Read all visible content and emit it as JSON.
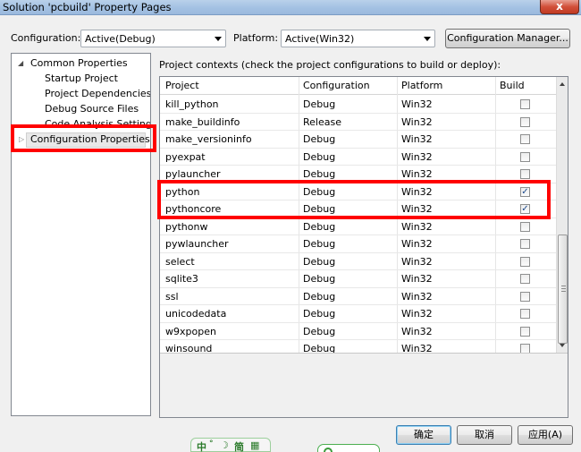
{
  "window": {
    "title": "Solution 'pcbuild' Property Pages",
    "close_label": "x"
  },
  "toolbar": {
    "configuration_label": "Configuration:",
    "configuration_value": "Active(Debug)",
    "platform_label": "Platform:",
    "platform_value": "Active(Win32)",
    "config_manager_label": "Configuration Manager..."
  },
  "tree": {
    "items": [
      {
        "label": "Common Properties"
      },
      {
        "label": "Startup Project"
      },
      {
        "label": "Project Dependencies"
      },
      {
        "label": "Debug Source Files"
      },
      {
        "label": "Code Analysis Settings"
      },
      {
        "label": "Configuration Properties"
      }
    ]
  },
  "main": {
    "instructions": "Project contexts (check the project configurations to build or deploy):",
    "columns": [
      "Project",
      "Configuration",
      "Platform",
      "Build"
    ],
    "rows": [
      {
        "project": "kill_python",
        "configuration": "Debug",
        "platform": "Win32",
        "build": false
      },
      {
        "project": "make_buildinfo",
        "configuration": "Release",
        "platform": "Win32",
        "build": false
      },
      {
        "project": "make_versioninfo",
        "configuration": "Debug",
        "platform": "Win32",
        "build": false
      },
      {
        "project": "pyexpat",
        "configuration": "Debug",
        "platform": "Win32",
        "build": false
      },
      {
        "project": "pylauncher",
        "configuration": "Debug",
        "platform": "Win32",
        "build": false
      },
      {
        "project": "python",
        "configuration": "Debug",
        "platform": "Win32",
        "build": true
      },
      {
        "project": "pythoncore",
        "configuration": "Debug",
        "platform": "Win32",
        "build": true
      },
      {
        "project": "pythonw",
        "configuration": "Debug",
        "platform": "Win32",
        "build": false
      },
      {
        "project": "pywlauncher",
        "configuration": "Debug",
        "platform": "Win32",
        "build": false
      },
      {
        "project": "select",
        "configuration": "Debug",
        "platform": "Win32",
        "build": false
      },
      {
        "project": "sqlite3",
        "configuration": "Debug",
        "platform": "Win32",
        "build": false
      },
      {
        "project": "ssl",
        "configuration": "Debug",
        "platform": "Win32",
        "build": false
      },
      {
        "project": "unicodedata",
        "configuration": "Debug",
        "platform": "Win32",
        "build": false
      },
      {
        "project": "w9xpopen",
        "configuration": "Debug",
        "platform": "Win32",
        "build": false
      },
      {
        "project": "winsound",
        "configuration": "Debug",
        "platform": "Win32",
        "build": false
      }
    ]
  },
  "buttons": {
    "ok": "确定",
    "cancel": "取消",
    "apply": "应用(A)"
  },
  "taskbar": {
    "ime_chars": [
      "中",
      "°",
      "☽",
      "简",
      "▦"
    ]
  },
  "colors": {
    "highlight_box": "#ff0000",
    "title_bar": "#a3c1e3"
  }
}
